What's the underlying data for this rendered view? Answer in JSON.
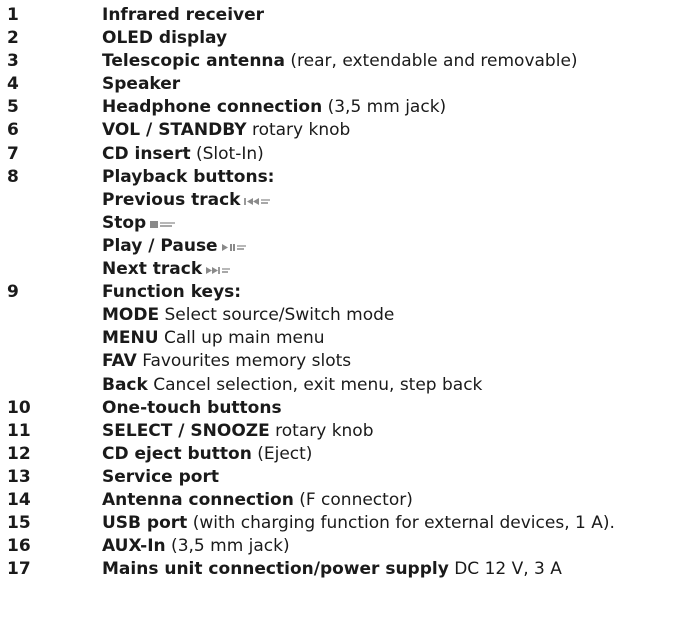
{
  "items": [
    {
      "num": "1",
      "bold": "Infrared receiver",
      "rest": ""
    },
    {
      "num": "2",
      "bold": "OLED display",
      "rest": ""
    },
    {
      "num": "3",
      "bold": "Telescopic antenna",
      "rest": " (rear, extendable and removable)"
    },
    {
      "num": "4",
      "bold": "Speaker",
      "rest": ""
    },
    {
      "num": "5",
      "bold": "Headphone connection",
      "rest": " (3,5 mm jack)"
    },
    {
      "num": "6",
      "bold": "VOL / STANDBY",
      "rest": " rotary knob"
    },
    {
      "num": "7",
      "bold": "CD insert",
      "rest": " (Slot-In)"
    },
    {
      "num": "8",
      "bold": "Playback buttons:",
      "rest": ""
    },
    {
      "num": "",
      "bold": "Previous track",
      "rest": ""
    },
    {
      "num": "",
      "bold": "Stop",
      "rest": ""
    },
    {
      "num": "",
      "bold": "Play / Pause",
      "rest": ""
    },
    {
      "num": "",
      "bold": "Next track",
      "rest": ""
    },
    {
      "num": "9",
      "bold": "Function keys:",
      "rest": ""
    },
    {
      "num": "",
      "bold": "MODE",
      "rest": " Select source/Switch mode"
    },
    {
      "num": "",
      "bold": "MENU",
      "rest": " Call up main menu"
    },
    {
      "num": "",
      "bold": "FAV",
      "rest": " Favourites memory slots"
    },
    {
      "num": "",
      "bold": "Back",
      "rest": " Cancel selection, exit menu, step back"
    },
    {
      "num": "10",
      "bold": "One-touch buttons",
      "rest": ""
    },
    {
      "num": "11",
      "bold": "SELECT / SNOOZE",
      "rest": " rotary knob"
    },
    {
      "num": "12",
      "bold": "CD eject button",
      "rest": " (Eject)"
    },
    {
      "num": "13",
      "bold": "Service port",
      "rest": ""
    },
    {
      "num": "14",
      "bold": "Antenna connection",
      "rest": " (F connector)"
    },
    {
      "num": "15",
      "bold": "USB port",
      "rest": " (with charging function for external devices, 1 A)."
    },
    {
      "num": "16",
      "bold": "AUX-In",
      "rest": " (3,5 mm jack)"
    },
    {
      "num": "17",
      "bold": "Mains unit connection/power supply",
      "rest": " DC 12 V, 3 A"
    }
  ],
  "icons": {
    "prev": "previous-track-icon",
    "stop": "stop-icon",
    "play": "play-pause-icon",
    "next": "next-track-icon"
  }
}
